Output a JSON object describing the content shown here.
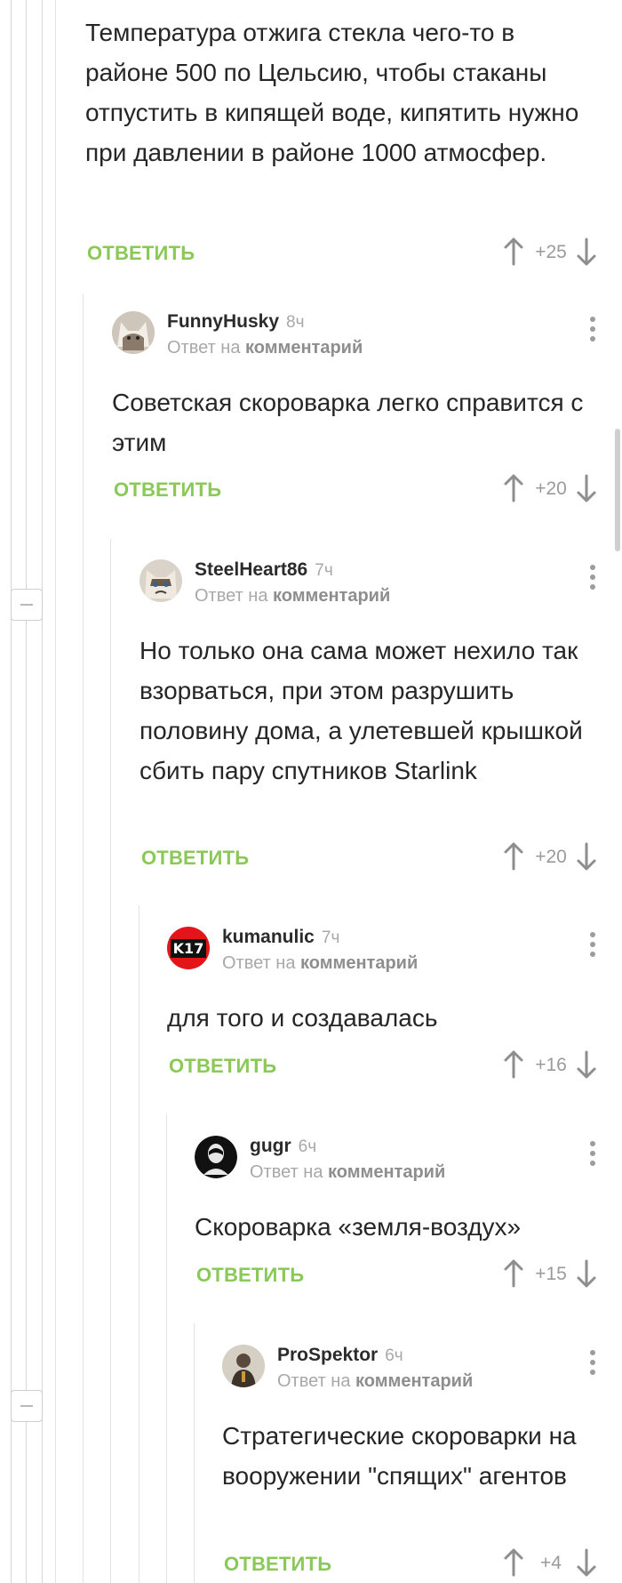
{
  "labels": {
    "reply_button": "ОТВЕТИТЬ",
    "reply_prefix": "Ответ на",
    "reply_target": "комментарий"
  },
  "colors": {
    "accent_green": "#8ac858",
    "meta_gray": "#a8a8a8"
  },
  "top_comment": {
    "text": "Температура отжига стекла чего-то в районе 500 по Цельсию, чтобы стаканы отпустить в кипящей воде, кипятить нужно при давлении в районе 1000 атмосфер.",
    "rating": "+25"
  },
  "comments": [
    {
      "author": "FunnyHusky",
      "time": "8ч",
      "text": "Советская скороварка легко справится с этим",
      "rating": "+20",
      "avatar_icon": "husky-avatar"
    },
    {
      "author": "SteelHeart86",
      "time": "7ч",
      "text": "Но только она сама может нехило так взорваться, при этом разрушить половину дома, а улетевшей крышкой сбить пару спутников Starlink",
      "rating": "+20",
      "avatar_icon": "grumpy-cat-avatar"
    },
    {
      "author": "kumanulic",
      "time": "7ч",
      "text": "для того и создавалась",
      "rating": "+16",
      "avatar_icon": "k17-logo-avatar",
      "avatar_text": "K17"
    },
    {
      "author": "gugr",
      "time": "6ч",
      "text": "Скороварка «земля-воздух»",
      "rating": "+15",
      "avatar_icon": "silhouette-avatar"
    },
    {
      "author": "ProSpektor",
      "time": "6ч",
      "text": "Стратегические скороварки на вооружении \"спящих\" агентов",
      "rating": "+4",
      "avatar_icon": "person-avatar"
    }
  ]
}
